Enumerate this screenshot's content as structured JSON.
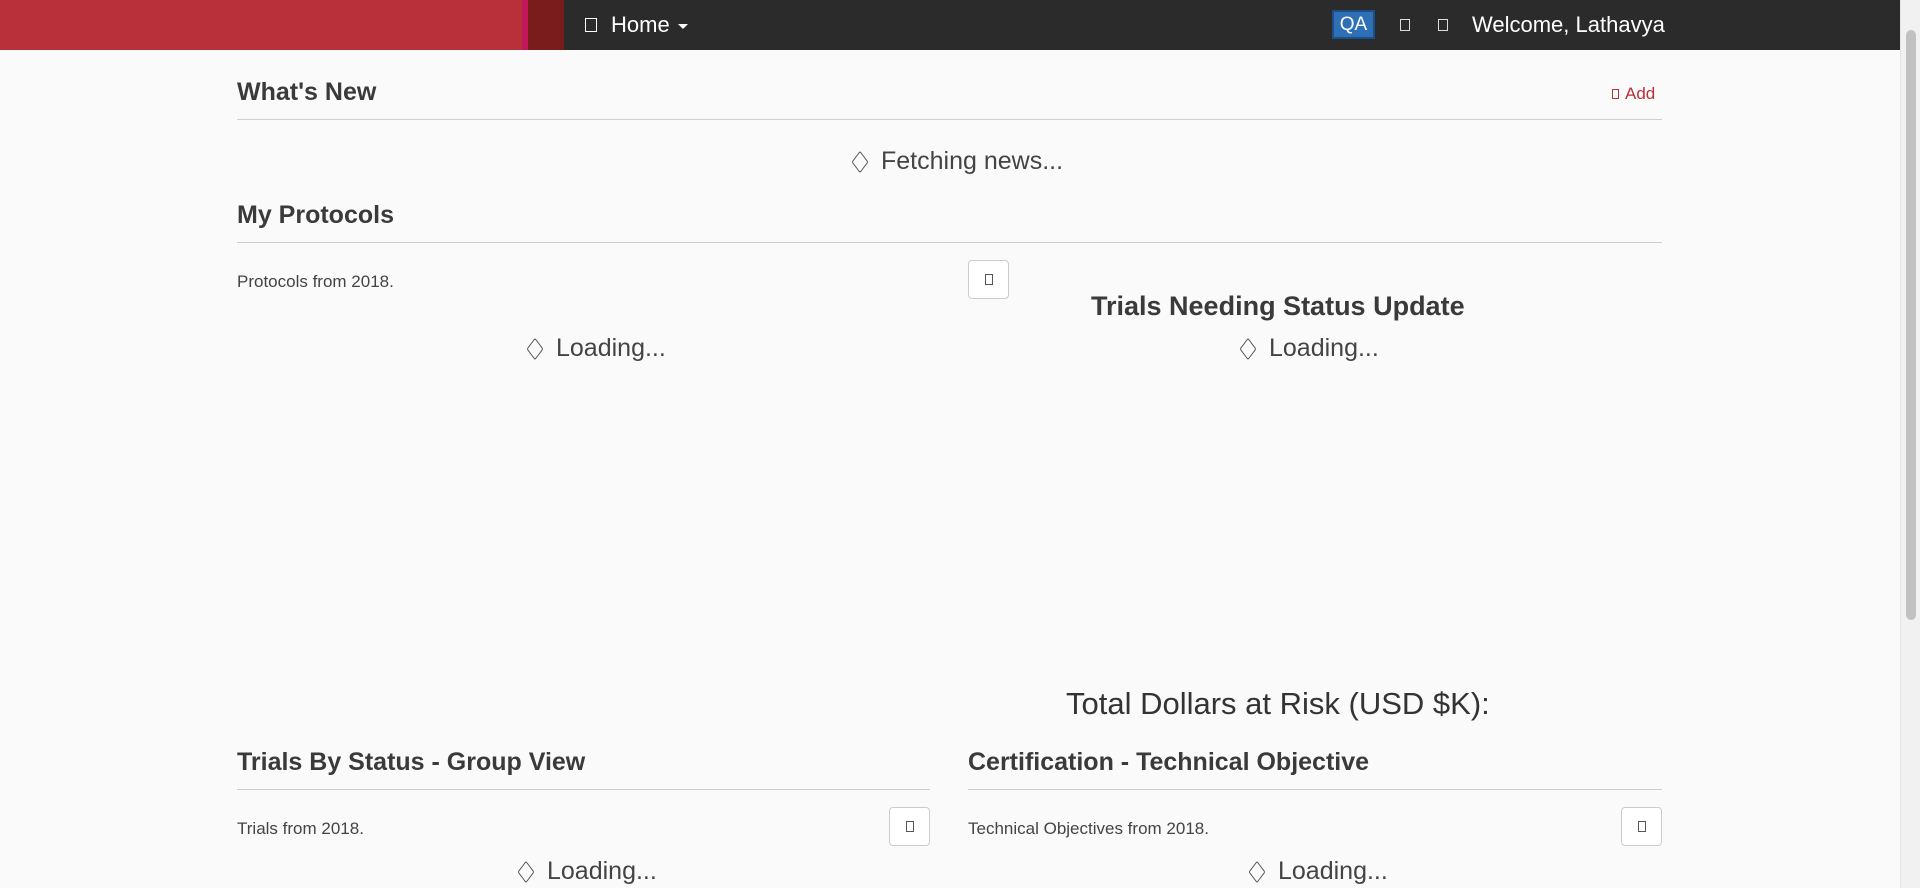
{
  "navbar": {
    "home_label": "Home",
    "env_badge": "QA",
    "welcome": "Welcome, Lathavya"
  },
  "whats_new": {
    "title": "What's New",
    "add_label": "Add",
    "loading": "Fetching news..."
  },
  "my_protocols": {
    "title": "My Protocols",
    "subtitle": "Protocols from 2018.",
    "loading": "Loading..."
  },
  "status_update": {
    "title": "Trials Needing Status Update",
    "loading": "Loading...",
    "dollars_at_risk": "Total Dollars at Risk (USD $K):"
  },
  "trials_by_status": {
    "title": "Trials By Status - Group View",
    "subtitle": "Trials from 2018.",
    "loading": "Loading..."
  },
  "certification": {
    "title": "Certification - Technical Objective",
    "subtitle": "Technical Objectives from 2018.",
    "loading": "Loading..."
  },
  "colors": {
    "brand": "#b92f3a",
    "navbar": "#2b2b2b",
    "env_badge": "#2e6fb5"
  }
}
